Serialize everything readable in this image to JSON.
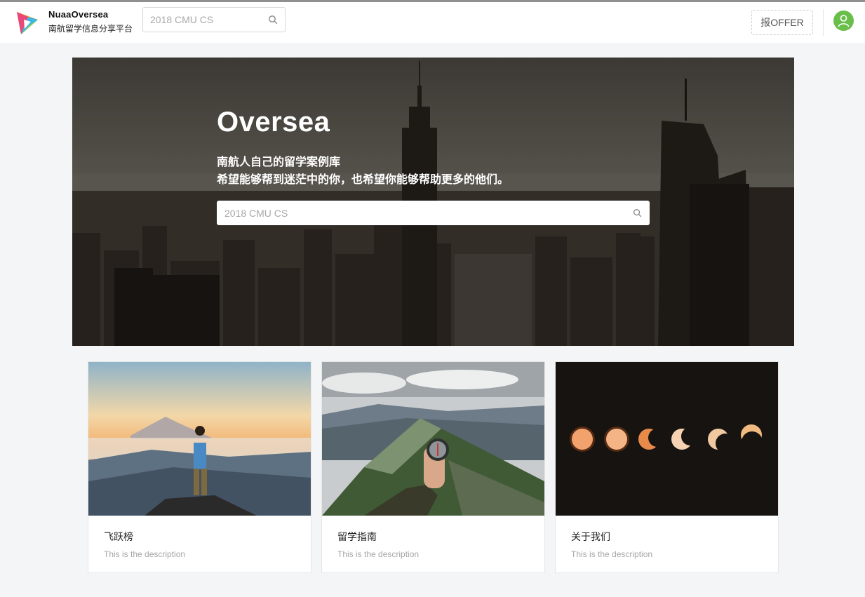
{
  "header": {
    "brand_title": "NuaaOversea",
    "brand_subtitle": "南航留学信息分享平台",
    "search_placeholder": "2018 CMU CS",
    "offer_button": "报OFFER"
  },
  "hero": {
    "title": "Oversea",
    "line1": "南航人自己的留学案例库",
    "line2": "希望能够帮到迷茫中的你，也希望你能够帮助更多的他们。",
    "search_placeholder": "2018 CMU CS"
  },
  "cards": [
    {
      "title": "飞跃榜",
      "description": "This is the description",
      "image": "person-on-mountain-sunset"
    },
    {
      "title": "留学指南",
      "description": "This is the description",
      "image": "hand-holding-compass-mountains"
    },
    {
      "title": "关于我们",
      "description": "This is the description",
      "image": "eclipse-phases"
    }
  ],
  "colors": {
    "accent_green": "#6abf4b",
    "page_bg": "#f4f5f7"
  }
}
